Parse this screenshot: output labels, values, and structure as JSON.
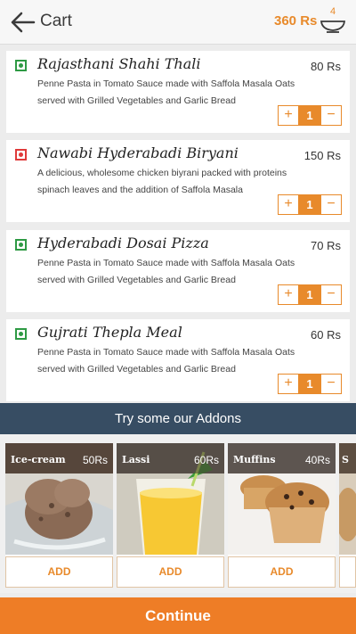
{
  "header": {
    "title": "Cart",
    "total": "360 Rs",
    "cart_count": "4",
    "back_icon": "arrow-left-icon",
    "bowl_icon": "bowl-icon"
  },
  "items": [
    {
      "name": "Rajasthani Shahi Thali",
      "price": "80 Rs",
      "type": "veg",
      "description": "Penne Pasta in Tomato Sauce made with Saffola Masala Oats served with Grilled Vegetables and Garlic Bread",
      "qty": "1",
      "plus": "+",
      "minus": "−"
    },
    {
      "name": "Nawabi Hyderabadi Biryani",
      "price": "150 Rs",
      "type": "non-veg",
      "description": "A delicious, wholesome chicken biyrani packed with proteins spinach leaves and the addition of Saffola Masala",
      "qty": "1",
      "plus": "+",
      "minus": "−"
    },
    {
      "name": "Hyderabadi Dosai Pizza",
      "price": "70 Rs",
      "type": "veg",
      "description": "Penne Pasta in Tomato Sauce made with Saffola Masala Oats served with Grilled Vegetables and Garlic Bread",
      "qty": "1",
      "plus": "+",
      "minus": "−"
    },
    {
      "name": "Gujrati Thepla Meal",
      "price": "60 Rs",
      "type": "veg",
      "description": "Penne Pasta in Tomato Sauce made with Saffola Masala Oats served with Grilled Vegetables and Garlic Bread",
      "qty": "1",
      "plus": "+",
      "minus": "−"
    }
  ],
  "addons": {
    "heading": "Try some our Addons",
    "list": [
      {
        "name": "Ice-cream",
        "price": "50Rs",
        "action": "ADD"
      },
      {
        "name": "Lassi",
        "price": "60Rs",
        "action": "ADD"
      },
      {
        "name": "Muffins",
        "price": "40Rs",
        "action": "ADD"
      },
      {
        "name": "S",
        "price": "",
        "action": ""
      }
    ]
  },
  "continue_label": "Continue",
  "colors": {
    "accent": "#ee7d26",
    "addons_bar": "#374d63",
    "veg": "#2e9a44",
    "non_veg": "#e03a3a"
  }
}
